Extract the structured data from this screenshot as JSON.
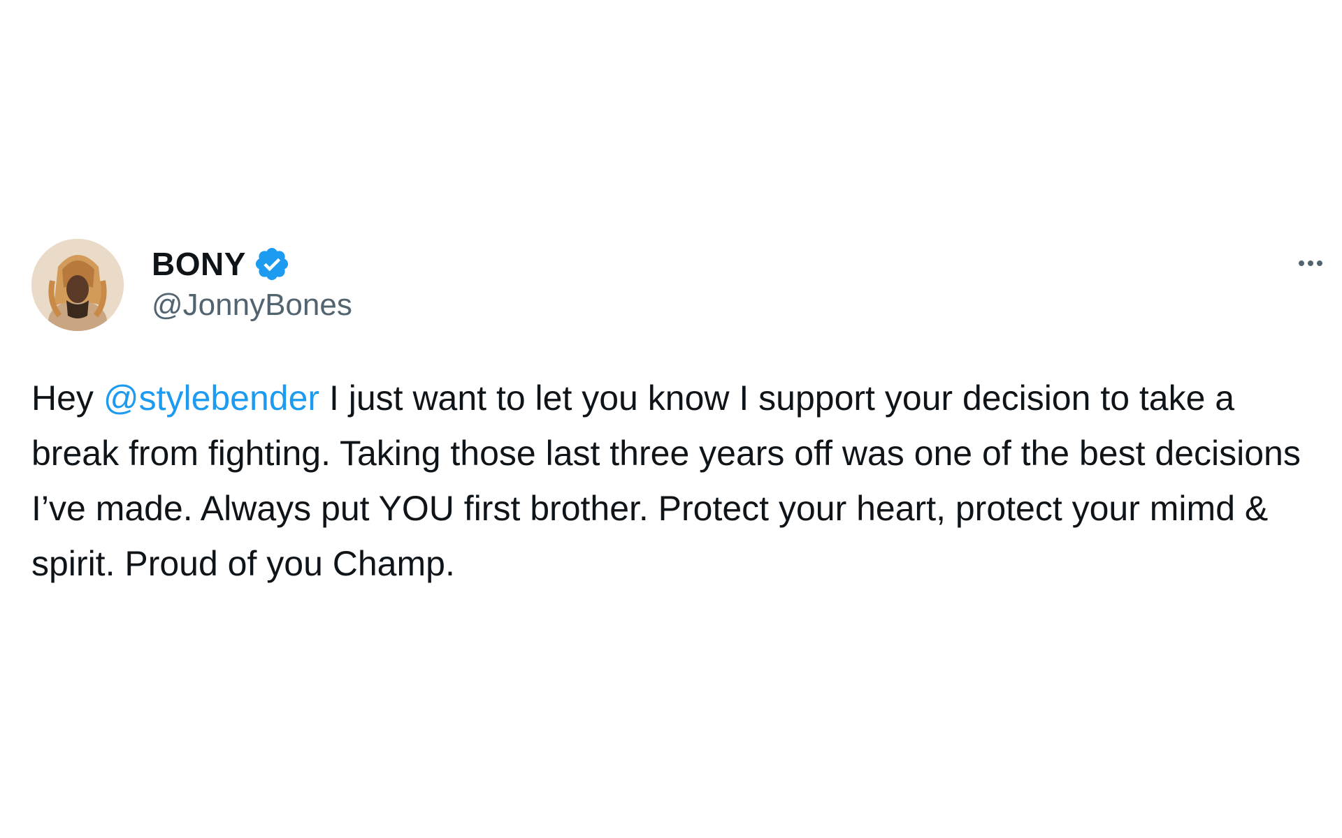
{
  "tweet": {
    "author": {
      "display_name": "BONY",
      "handle": "@JonnyBones",
      "verified": true,
      "avatar_icon": "profile-avatar-lion-headdress"
    },
    "menu_icon": "more-options-icon",
    "body": {
      "prefix": "Hey ",
      "mention": "@stylebender",
      "text": " I just want to let you know I support your decision to take a break from fighting. Taking those last three years off was one of the best decisions I’ve made. Always put YOU first brother. Protect your heart, protect your mimd & spirit. Proud of you Champ."
    }
  },
  "colors": {
    "text": "#0f1419",
    "secondary": "#536471",
    "link": "#1d9bf0",
    "verified_badge": "#1d9bf0",
    "background": "#ffffff"
  }
}
